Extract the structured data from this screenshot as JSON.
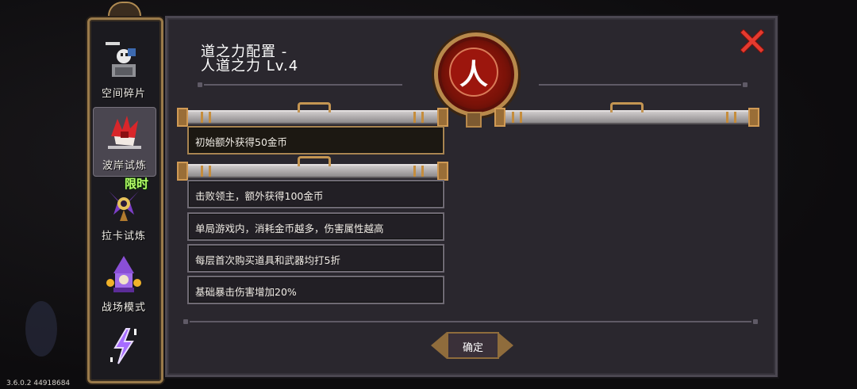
{
  "sidebar": {
    "items": [
      {
        "label": "空间碎片",
        "icon": "space-shard-icon"
      },
      {
        "label": "波岸试炼",
        "icon": "red-beast-icon"
      },
      {
        "label": "拉卡试炼",
        "icon": "laka-sigil-icon",
        "tag": "限时"
      },
      {
        "label": "战场模式",
        "icon": "wizard-icon"
      },
      {
        "label": "",
        "icon": "lightning-rune-icon"
      }
    ],
    "active_index": 1
  },
  "panel": {
    "title_line1": "道之力配置 -",
    "title_line2": "人道之力 Lv.4",
    "emblem_glyph": "人",
    "emblem_icon": "human-dao-emblem-icon",
    "close_icon": "close-x-icon"
  },
  "effects": {
    "tier1": [
      "初始额外获得50金币"
    ],
    "tier2": [
      "击败领主，额外获得100金币",
      "单局游戏内，消耗金币越多，伤害属性越高",
      "每层首次购买道具和武器均打5折",
      "基础暴击伤害增加20%"
    ]
  },
  "confirm_label": "确定",
  "version": "3.6.0.2 44918684",
  "colors": {
    "panel_bg": "#2a272e",
    "gold_frame": "#b8894b",
    "emblem_red": "#9c160d",
    "close_red": "#e53a2f",
    "limited_green": "#b8ff6a"
  }
}
